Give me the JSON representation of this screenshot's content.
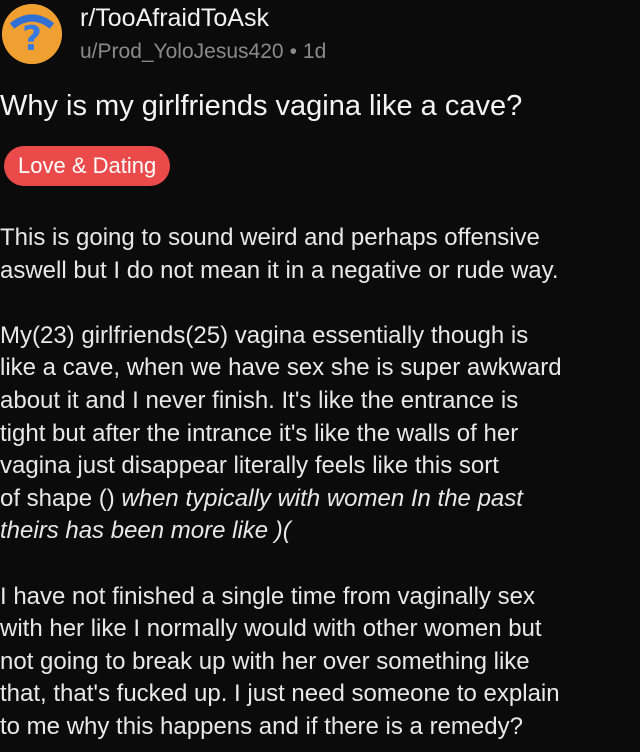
{
  "post": {
    "subreddit": "r/TooAfraidToAsk",
    "author": "u/Prod_YoloJesus420",
    "separator": "•",
    "age": "1d",
    "title": "Why is my girlfriends vagina like a cave?",
    "flair": "Love & Dating",
    "body": {
      "p1_line1": "This is going to sound weird and perhaps offensive",
      "p1_line2": "aswell but I do not mean it in a negative or rude way.",
      "p2_line1": "My(23) girlfriends(25) vagina essentially though is",
      "p2_line2": "like a cave, when we have sex she is super awkward",
      "p2_line3": "about it and I never finish. It's like the entrance is",
      "p2_line4": "tight but after the intrance it's like the walls of her",
      "p2_line5": "vagina just disappear literally feels like this sort",
      "p2_line6_a": "of shape () ",
      "p2_line6_b": "when typically with women In the past",
      "p2_line7": "theirs has been more like )(",
      "p3_line1": "I have not finished a single time from vaginally sex",
      "p3_line2": "with her like I normally would with other women but",
      "p3_line3": "not going to break up with her over something like",
      "p3_line4": "that, that's fucked up. I just need someone to explain",
      "p3_line5": "to me why this happens and if there is a remedy?"
    }
  },
  "colors": {
    "background": "#0b0b0b",
    "flair_bg": "#ea4a4a",
    "avatar_bg": "#f0a030",
    "meta_text": "#8a8a8a"
  },
  "icons": {
    "avatar": "subreddit-question-mark-icon"
  }
}
